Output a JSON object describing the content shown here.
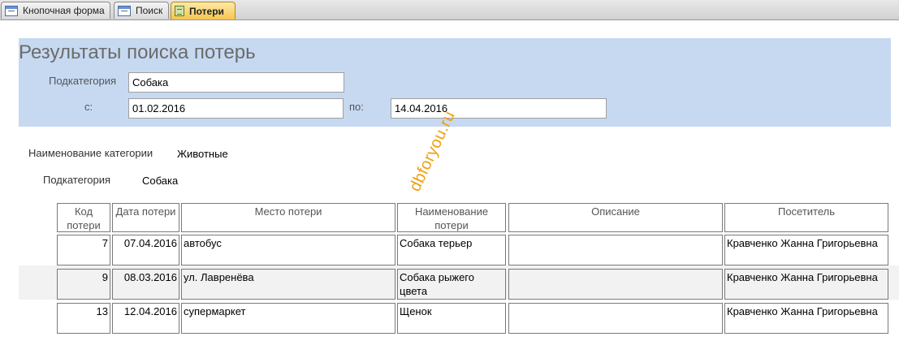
{
  "tabs": [
    {
      "label": "Кнопочная форма"
    },
    {
      "label": "Поиск"
    },
    {
      "label": "Потери"
    }
  ],
  "header": {
    "title": "Результаты поиска потерь",
    "subcategory_label": "Подкатегория",
    "subcategory_value": "Собака",
    "from_label": "с:",
    "from_value": "01.02.2016",
    "to_label": "по:",
    "to_value": "14.04.2016"
  },
  "details": {
    "category_label": "Наименование категории",
    "category_value": "Животные",
    "subcategory_label": "Подкатегория",
    "subcategory_value": "Собака"
  },
  "watermark": "dbforyou.ru",
  "table": {
    "columns": [
      "Код потери",
      "Дата потери",
      "Место потери",
      "Наименование потери",
      "Описание",
      "Посетитель"
    ],
    "rows": [
      {
        "id": "7",
        "date": "07.04.2016",
        "place": "автобус",
        "name": "Собака терьер",
        "desc": "",
        "visitor": "Кравченко Жанна Григорьевна"
      },
      {
        "id": "9",
        "date": "08.03.2016",
        "place": "ул. Лавренёва",
        "name": "Собака рыжего цвета",
        "desc": "",
        "visitor": "Кравченко Жанна Григорьевна"
      },
      {
        "id": "13",
        "date": "12.04.2016",
        "place": "супермаркет",
        "name": "Щенок",
        "desc": "",
        "visitor": "Кравченко Жанна Григорьевна"
      }
    ]
  }
}
